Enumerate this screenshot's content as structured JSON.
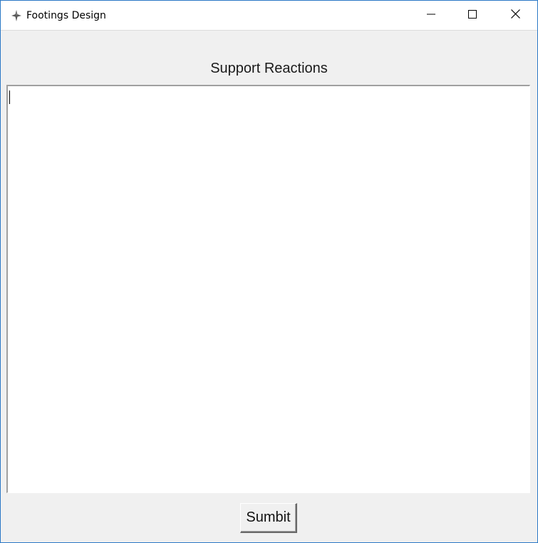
{
  "window": {
    "title": "Footings Design",
    "icon": "feather-icon",
    "controls": {
      "minimize_icon": "minimize-icon",
      "maximize_icon": "maximize-icon",
      "close_icon": "close-icon"
    },
    "accent_color": "#2b78c6"
  },
  "main": {
    "heading": "Support Reactions",
    "text_input_value": ""
  },
  "actions": {
    "submit_label": "Sumbit"
  }
}
